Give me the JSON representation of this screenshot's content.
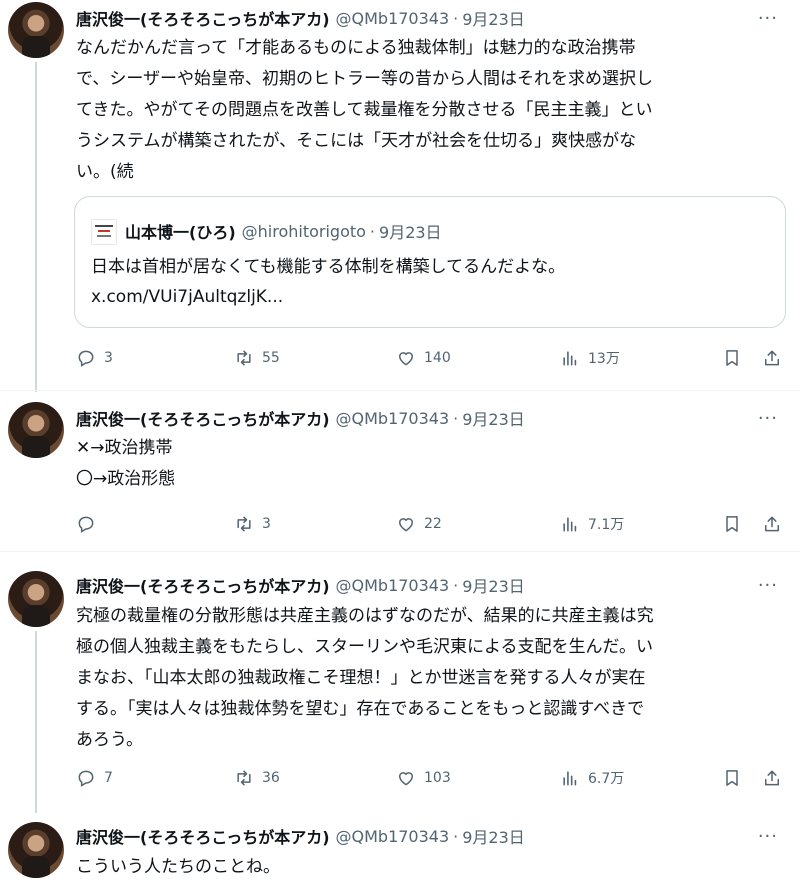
{
  "tweets": [
    {
      "author_name": "唐沢俊一(そろそろこっちが本アカ)",
      "handle": "@QMb170343",
      "dot": "·",
      "date": "9月23日",
      "more": "···",
      "lines": [
        "なんだかんだ言って「才能あるものによる独裁体制」は魅力的な政治携帯",
        "で、シーザーや始皇帝、初期のヒトラー等の昔から人間はそれを求め選択し",
        "てきた。やがてその問題点を改善して裁量権を分散させる「民主主義」とい",
        "うシステムが構築されたが、そこには「天才が社会を仕切る」爽快感がな",
        "い。(続"
      ],
      "quote": {
        "author_name": "山本博一(ひろ)",
        "handle": "@hirohitorigoto",
        "dot": "·",
        "date": "9月23日",
        "text": "日本は首相が居なくても機能する体制を構築してるんだよな。",
        "link": "x.com/VUi7jAultqzljK..."
      },
      "replies": "3",
      "retweets": "55",
      "likes": "140",
      "views": "13万"
    },
    {
      "author_name": "唐沢俊一(そろそろこっちが本アカ)",
      "handle": "@QMb170343",
      "dot": "·",
      "date": "9月23日",
      "more": "···",
      "lines": [
        "✕→政治携帯",
        "〇→政治形態"
      ],
      "replies": "",
      "retweets": "3",
      "likes": "22",
      "views": "7.1万"
    },
    {
      "author_name": "唐沢俊一(そろそろこっちが本アカ)",
      "handle": "@QMb170343",
      "dot": "·",
      "date": "9月23日",
      "more": "···",
      "lines": [
        "究極の裁量権の分散形態は共産主義のはずなのだが、結果的に共産主義は究",
        "極の個人独裁主義をもたらし、スターリンや毛沢東による支配を生んだ。い",
        "まなお、「山本太郎の独裁政権こそ理想！」とか世迷言を発する人々が実在",
        "する。「実は人々は独裁体勢を望む」存在であることをもっと認識すべきで",
        "あろう。"
      ],
      "replies": "7",
      "retweets": "36",
      "likes": "103",
      "views": "6.7万"
    },
    {
      "author_name": "唐沢俊一(そろそろこっちが本アカ)",
      "handle": "@QMb170343",
      "dot": "·",
      "date": "9月23日",
      "more": "···",
      "lines": [
        "こういう人たちのことね。"
      ]
    }
  ],
  "icons": {
    "reply": "reply-icon",
    "retweet": "retweet-icon",
    "like": "heart-icon",
    "views": "views-icon",
    "bookmark": "bookmark-icon",
    "share": "share-icon",
    "more": "more-icon"
  },
  "colors": {
    "text": "#0f1419",
    "secondary": "#536471",
    "border": "#cfd9de",
    "divider": "#eff3f4"
  }
}
